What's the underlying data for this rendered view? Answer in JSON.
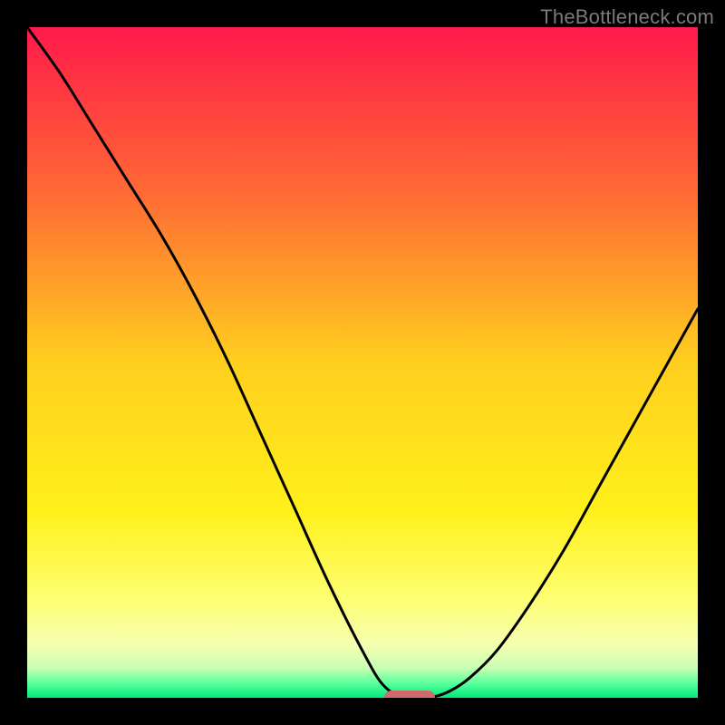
{
  "watermark": "TheBottleneck.com",
  "chart_data": {
    "type": "line",
    "title": "",
    "xlabel": "",
    "ylabel": "",
    "xlim": [
      0,
      100
    ],
    "ylim": [
      0,
      100
    ],
    "grid": false,
    "legend": false,
    "series": [
      {
        "name": "bottleneck-curve",
        "x": [
          0,
          5,
          10,
          15,
          20,
          25,
          30,
          35,
          40,
          45,
          50,
          53,
          56,
          58,
          60,
          63,
          66,
          70,
          75,
          80,
          85,
          90,
          95,
          100
        ],
        "y": [
          100,
          93,
          85,
          77,
          69,
          60,
          50,
          39,
          28,
          17,
          7,
          2,
          0,
          0,
          0,
          1,
          3,
          7,
          14,
          22,
          31,
          40,
          49,
          58
        ]
      }
    ],
    "marker": {
      "x": 57,
      "y": 0,
      "color": "#cf6a6f"
    },
    "background_gradient": {
      "stops": [
        {
          "pos": 0.0,
          "color": "#ff1a4b"
        },
        {
          "pos": 0.25,
          "color": "#ff6b34"
        },
        {
          "pos": 0.5,
          "color": "#ffcf1f"
        },
        {
          "pos": 0.72,
          "color": "#fff01a"
        },
        {
          "pos": 0.85,
          "color": "#fdff70"
        },
        {
          "pos": 0.92,
          "color": "#f6ffb0"
        },
        {
          "pos": 0.955,
          "color": "#c9ffb5"
        },
        {
          "pos": 0.98,
          "color": "#52ff9a"
        },
        {
          "pos": 1.0,
          "color": "#00e878"
        }
      ]
    }
  }
}
